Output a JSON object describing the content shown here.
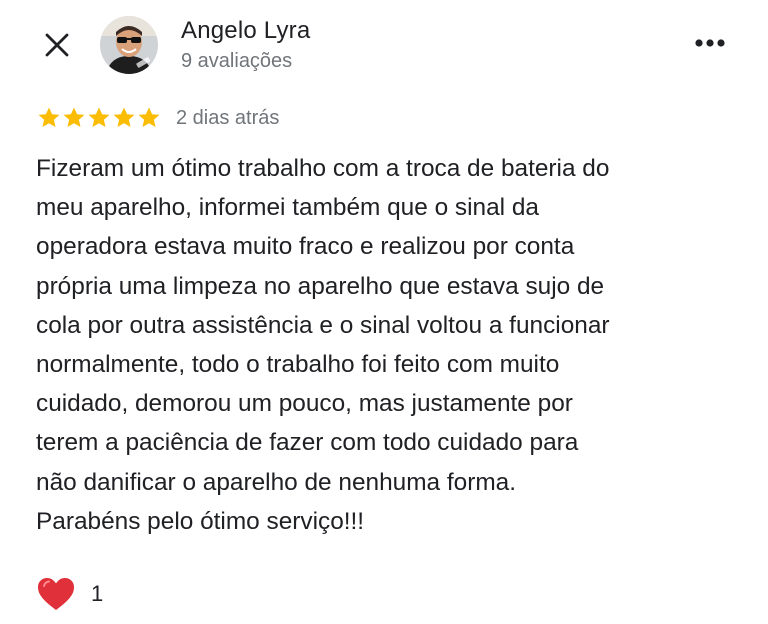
{
  "header": {
    "close_icon": "close-icon",
    "more_icon": "more-horizontal-icon"
  },
  "reviewer": {
    "name": "Angelo Lyra",
    "reviews_count": "9 avaliações",
    "avatar_icon": "avatar-photo"
  },
  "review": {
    "rating": 5,
    "max_rating": 5,
    "star_color": "#fbbc04",
    "date": "2 dias atrás",
    "text": "Fizeram um ótimo trabalho com a troca de bateria do\nmeu aparelho, informei também que o sinal da\noperadora estava muito fraco e realizou por conta\nprópria uma limpeza no aparelho que estava sujo de\ncola por outra assistência e o sinal voltou a funcionar\nnormalmente, todo o trabalho foi feito com muito\ncuidado, demorou um pouco, mas justamente por\nterem a paciência de fazer com todo cuidado para\nnão danificar o aparelho de nenhuma forma.\nParabéns pelo ótimo serviço!!!"
  },
  "reaction": {
    "icon": "heart-icon",
    "color": "#e0303a",
    "count": "1"
  }
}
